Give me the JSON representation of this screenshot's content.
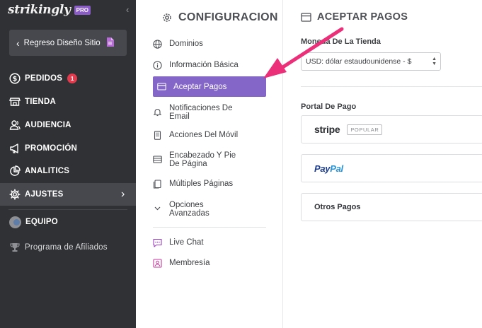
{
  "brand": {
    "name": "strikingly",
    "badge": "PRO"
  },
  "sidebar": {
    "collapse_icon": "‹",
    "back_button": {
      "label": "Regreso Diseño Sitio",
      "icon": "document-icon"
    },
    "items": [
      {
        "label": "PEDIDOS",
        "icon": "dollar-circle-icon",
        "badge": "1"
      },
      {
        "label": "TIENDA",
        "icon": "store-icon"
      },
      {
        "label": "AUDIENCIA",
        "icon": "users-icon"
      },
      {
        "label": "PROMOCIÓN",
        "icon": "megaphone-icon"
      },
      {
        "label": "ANALITICS",
        "icon": "pie-chart-icon"
      },
      {
        "label": "AJUSTES",
        "icon": "gear-icon",
        "active": true,
        "arrow": "›"
      },
      {
        "label": "EQUIPO",
        "icon": "team-avatar-icon"
      },
      {
        "label": "Programa de Afiliados",
        "icon": "trophy-icon"
      }
    ]
  },
  "settings": {
    "title": "CONFIGURACION",
    "items": [
      {
        "label": "Dominios",
        "icon": "globe-icon"
      },
      {
        "label": "Información Básica",
        "icon": "info-icon"
      },
      {
        "label": "Aceptar Pagos",
        "icon": "card-icon",
        "active": true
      },
      {
        "label_line1": "Notificaciones De",
        "label_line2": "Email",
        "icon": "bell-icon"
      },
      {
        "label": "Acciones Del Móvil",
        "icon": "mobile-icon"
      },
      {
        "label_line1": "Encabezado Y Pie",
        "label_line2": "De Página",
        "icon": "layout-icon"
      },
      {
        "label": "Múltiples Páginas",
        "icon": "pages-icon"
      },
      {
        "label_line1": "Opciones",
        "label_line2": "Avanzadas",
        "icon": "chevron-down-icon"
      },
      {
        "label": "Live Chat",
        "icon": "chat-icon"
      },
      {
        "label": "Membresía",
        "icon": "member-icon"
      }
    ]
  },
  "main": {
    "title": "ACEPTAR PAGOS",
    "currency": {
      "label": "Moneda De La Tienda",
      "value": "USD: dólar estaudounidense - $"
    },
    "gateway": {
      "label": "Portal De Pago",
      "stripe": {
        "logo": "stripe",
        "badge": "POPULAR"
      },
      "paypal": {
        "logo_pay": "Pay",
        "logo_pal": "Pal"
      },
      "other": "Otros Pagos"
    }
  },
  "colors": {
    "sidebar_bg": "#303134",
    "sidebar_active": "#46484d",
    "accent_purple": "#8466c8",
    "badge_red": "#e23b4e",
    "callout_pink": "#ec2f79"
  }
}
